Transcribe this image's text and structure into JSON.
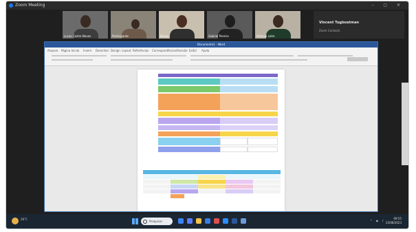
{
  "window": {
    "title": "Zoom Meeting"
  },
  "participants": [
    {
      "name": "Lucas Castro Neves"
    },
    {
      "name": "Participante"
    },
    {
      "name": "Bruna"
    },
    {
      "name": "Gabriel Pereira"
    },
    {
      "name": "Antonio Leite"
    }
  ],
  "speaker_panel": {
    "title": "Vincent Tugboatman",
    "subtitle": "Zoom Contacts"
  },
  "word": {
    "title": "Documento1 - Word",
    "tabs": [
      "Arquivo",
      "Página Inicial",
      "Inserir",
      "Desenhar",
      "Design",
      "Layout",
      "Referências",
      "Correspondências",
      "Revisão",
      "Exibir",
      "Ajuda"
    ]
  },
  "taskbar": {
    "weather": "28°C",
    "weather_sub": "Parc. ensolarado",
    "search_placeholder": "Pesquisar",
    "time": "09:55",
    "date": "23/08/2023"
  },
  "colors": {
    "header_purple": "#7b68c9",
    "header_blue": "#58b7e3",
    "teal": "#5cc9c2",
    "green": "#7bc96a",
    "orange": "#f4a25a",
    "yellow": "#f7d54a",
    "lavender": "#b9a6ee",
    "light_blue": "#b9def4",
    "accent_blue": "#2b579a"
  }
}
